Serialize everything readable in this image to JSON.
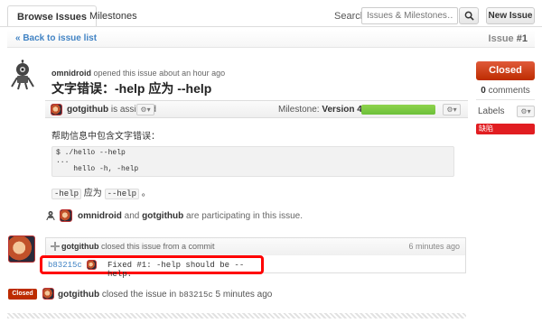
{
  "tabs": [
    {
      "label": "Browse Issues",
      "active": true
    },
    {
      "label": "Milestones",
      "active": false
    }
  ],
  "search": {
    "label": "Search:",
    "placeholder": "Issues & Milestones…",
    "button_icon": "search-icon"
  },
  "toolbar": {
    "new_issue_label": "New Issue"
  },
  "back": {
    "label": "« Back to issue list"
  },
  "issue": {
    "number_prefix": "Issue",
    "number": "#1",
    "author": "omnidroid",
    "opened_text": "opened this issue about an hour ago",
    "title": "文字错误：-help 应为 --help",
    "assignee": "gotgithub",
    "assigned_text": "is assigned",
    "milestone_label": "Milestone:",
    "milestone_name": "Version 4.0",
    "milestone_progress": 1.0,
    "body_intro": "帮助信息中包含文字错误：",
    "code_lines": [
      "$ ./hello --help",
      "...",
      "    hello -h, -help"
    ],
    "inline": {
      "code1": "-help",
      "between": " 应为 ",
      "code2": "--help",
      "end": " 。"
    }
  },
  "sidebar": {
    "status_button": "Closed",
    "comments_count": "0",
    "comments_label": "comments",
    "labels_title": "Labels",
    "labels": [
      {
        "name": "缺陷",
        "color": "#e11d21"
      }
    ]
  },
  "participants": {
    "user1": "omnidroid",
    "and": "and",
    "user2": "gotgithub",
    "suffix": "are participating in this issue."
  },
  "event": {
    "user": "gotgithub",
    "text": "closed this issue from a commit",
    "time": "6 minutes ago",
    "commit_sha": "b83215c",
    "commit_message": "Fixed #1: -help should be --help."
  },
  "closed_event": {
    "badge": "Closed",
    "user": "gotgithub",
    "text": "closed the issue in",
    "sha": "b83215c",
    "time": "5 minutes ago"
  },
  "colors": {
    "link": "#4183c4",
    "closed": "#bd2c00",
    "label_bug": "#e11d21",
    "progress": "#6cc03a",
    "highlight": "#ff0000"
  }
}
